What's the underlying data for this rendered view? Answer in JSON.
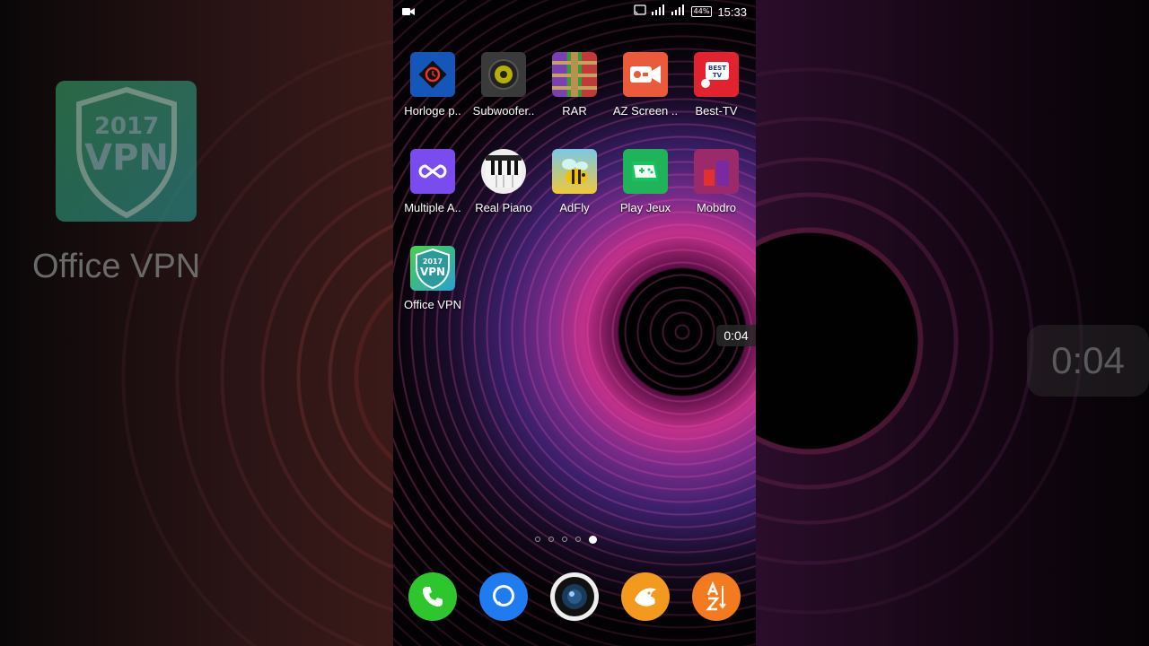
{
  "status_bar": {
    "battery": "44%",
    "time": "15:33"
  },
  "apps": [
    {
      "label": "Horloge p..",
      "icon": "clock-app-icon"
    },
    {
      "label": "Subwoofer..",
      "icon": "speaker-app-icon"
    },
    {
      "label": "RAR",
      "icon": "rar-archive-icon"
    },
    {
      "label": "AZ Screen ..",
      "icon": "screen-recorder-icon"
    },
    {
      "label": "Best-TV",
      "icon": "tv-app-icon"
    },
    {
      "label": "Multiple A..",
      "icon": "infinity-app-icon"
    },
    {
      "label": "Real Piano",
      "icon": "piano-app-icon"
    },
    {
      "label": "AdFly",
      "icon": "bee-app-icon"
    },
    {
      "label": "Play Jeux",
      "icon": "gamepad-app-icon"
    },
    {
      "label": "Mobdro",
      "icon": "mobdro-app-icon"
    },
    {
      "label": "Office VPN",
      "icon": "vpn-shield-icon"
    }
  ],
  "vpn_badge": {
    "year": "2017",
    "text": "VPN"
  },
  "best_tv_badge": {
    "line1": "BEST",
    "line2": "TV"
  },
  "dock": [
    {
      "icon": "phone-icon"
    },
    {
      "icon": "messages-icon"
    },
    {
      "icon": "camera-icon"
    },
    {
      "icon": "browser-icon"
    },
    {
      "icon": "az-sort-icon"
    }
  ],
  "page_indicator": {
    "total": 5,
    "active": 5
  },
  "recording_timer": "0:04",
  "blurred_background": {
    "label": "Office VPN",
    "timer": "0:04"
  },
  "colors": {
    "phone_green": "#2dc72d",
    "messages_blue": "#1e7bf0",
    "browser_orange": "#f39a1e",
    "az_orange": "#f37a1e"
  }
}
